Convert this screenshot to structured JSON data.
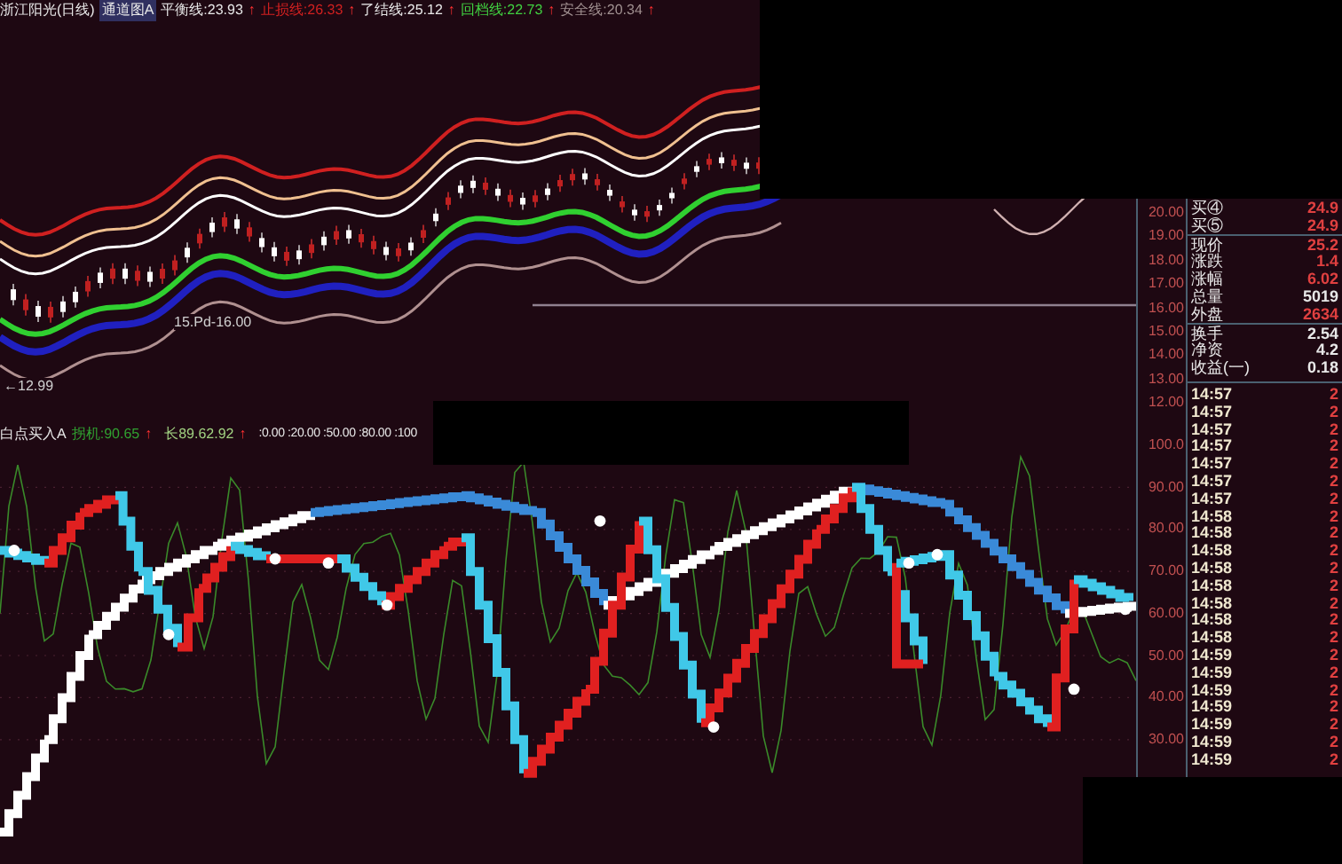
{
  "header": {
    "title": "浙江阳光(日线)",
    "indicator": "通道图A",
    "lines": [
      {
        "label": "平衡线:23.93",
        "color": "#e8e8e8",
        "arrow": "↑"
      },
      {
        "label": "止损线:26.33",
        "color": "#d02020",
        "arrow": "↑"
      },
      {
        "label": "了结线:25.12",
        "color": "#e8e8e8",
        "arrow": "↑"
      },
      {
        "label": "回档线:22.73",
        "color": "#40d040",
        "arrow": "↑"
      },
      {
        "label": "安全线:20.34",
        "color": "#a09090",
        "arrow": "↑"
      }
    ]
  },
  "upper_chart": {
    "annotations": [
      "15.Pd-16.00",
      "←12.99"
    ],
    "price_labels": [
      "20.00",
      "19.00",
      "18.00",
      "17.00",
      "16.00",
      "15.00",
      "14.00",
      "13.00",
      "12.00"
    ]
  },
  "lower_header": {
    "title": "白点买入A",
    "lines": [
      {
        "label": "拐机:90.65",
        "color": "#30a030",
        "arrow": "↑"
      },
      {
        "label": "长89.62.92",
        "color": "#a0d080",
        "arrow": "↑"
      }
    ],
    "levels": ":0.00 :20.00 :50.00 :80.00 :100"
  },
  "lower_chart": {
    "value_labels": [
      "100.0",
      "90.00",
      "80.00",
      "70.00",
      "60.00",
      "50.00",
      "40.00",
      "30.00"
    ]
  },
  "quote_panel": {
    "rows": [
      {
        "label": "买④",
        "value": "24.9",
        "color": "#e04040"
      },
      {
        "label": "买⑤",
        "value": "24.9",
        "color": "#e04040"
      },
      {
        "label": "现价",
        "value": "25.2",
        "color": "#e04040"
      },
      {
        "label": "涨跌",
        "value": "1.4",
        "color": "#e04040"
      },
      {
        "label": "涨幅",
        "value": "6.02",
        "color": "#e04040"
      },
      {
        "label": "总量",
        "value": "5019",
        "color": "#e8e8e8"
      },
      {
        "label": "外盘",
        "value": "2634",
        "color": "#e04040"
      },
      {
        "label": "换手",
        "value": "2.54",
        "color": "#e8e8e8"
      },
      {
        "label": "净资",
        "value": "4.2",
        "color": "#e8e8e8"
      },
      {
        "label": "收益(一)",
        "value": "0.18",
        "color": "#e8e8e8"
      }
    ],
    "ticks": [
      {
        "time": "14:57",
        "value": "2"
      },
      {
        "time": "14:57",
        "value": "2"
      },
      {
        "time": "14:57",
        "value": "2"
      },
      {
        "time": "14:57",
        "value": "2"
      },
      {
        "time": "14:57",
        "value": "2"
      },
      {
        "time": "14:57",
        "value": "2"
      },
      {
        "time": "14:57",
        "value": "2"
      },
      {
        "time": "14:58",
        "value": "2"
      },
      {
        "time": "14:58",
        "value": "2"
      },
      {
        "time": "14:58",
        "value": "2"
      },
      {
        "time": "14:58",
        "value": "2"
      },
      {
        "time": "14:58",
        "value": "2"
      },
      {
        "time": "14:58",
        "value": "2"
      },
      {
        "time": "14:58",
        "value": "2"
      },
      {
        "time": "14:58",
        "value": "2"
      },
      {
        "time": "14:59",
        "value": "2"
      },
      {
        "time": "14:59",
        "value": "2"
      },
      {
        "time": "14:59",
        "value": "2"
      },
      {
        "time": "14:59",
        "value": "2"
      },
      {
        "time": "14:59",
        "value": "2"
      },
      {
        "time": "14:59",
        "value": "2"
      },
      {
        "time": "14:59",
        "value": "2"
      }
    ]
  }
}
